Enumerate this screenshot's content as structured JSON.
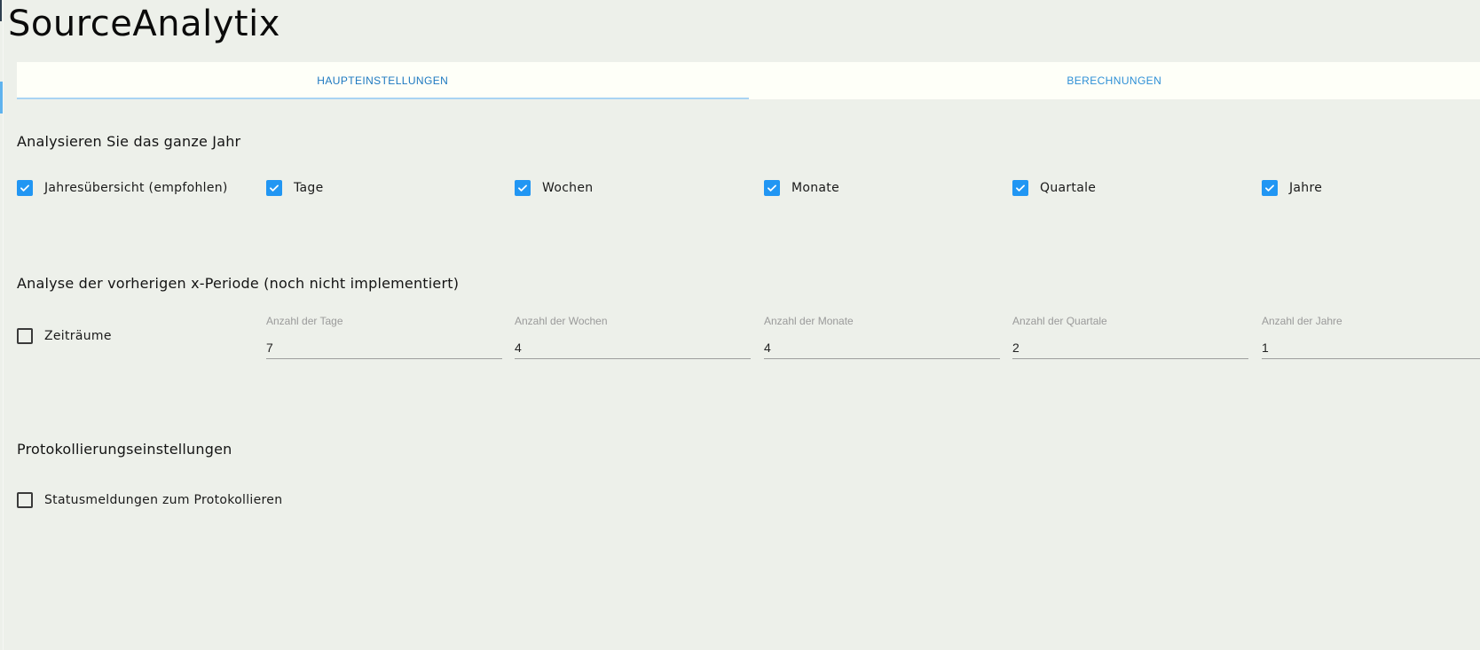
{
  "app": {
    "title": "SourceAnalytix"
  },
  "tabs": [
    {
      "label": "HAUPTEINSTELLUNGEN",
      "active": true
    },
    {
      "label": "BERECHNUNGEN",
      "active": false
    }
  ],
  "sections": {
    "year_analysis": {
      "title": "Analysieren Sie das ganze Jahr",
      "options": [
        {
          "label": "Jahresübersicht (empfohlen)",
          "checked": true
        },
        {
          "label": "Tage",
          "checked": true
        },
        {
          "label": "Wochen",
          "checked": true
        },
        {
          "label": "Monate",
          "checked": true
        },
        {
          "label": "Quartale",
          "checked": true
        },
        {
          "label": "Jahre",
          "checked": true
        }
      ]
    },
    "previous_period": {
      "title": "Analyse der vorherigen x-Periode (noch nicht implementiert)",
      "toggle": {
        "label": "Zeiträume",
        "checked": false
      },
      "fields": [
        {
          "label": "Anzahl der Tage",
          "value": "7"
        },
        {
          "label": "Anzahl der Wochen",
          "value": "4"
        },
        {
          "label": "Anzahl der Monate",
          "value": "4"
        },
        {
          "label": "Anzahl der Quartale",
          "value": "2"
        },
        {
          "label": "Anzahl der Jahre",
          "value": "1"
        }
      ]
    },
    "logging": {
      "title": "Protokollierungseinstellungen",
      "toggle": {
        "label": "Statusmeldungen zum Protokollieren",
        "checked": false
      }
    }
  },
  "colors": {
    "accent": "#2196f3",
    "background": "#edf0ea",
    "tabbar": "#fefff8"
  }
}
